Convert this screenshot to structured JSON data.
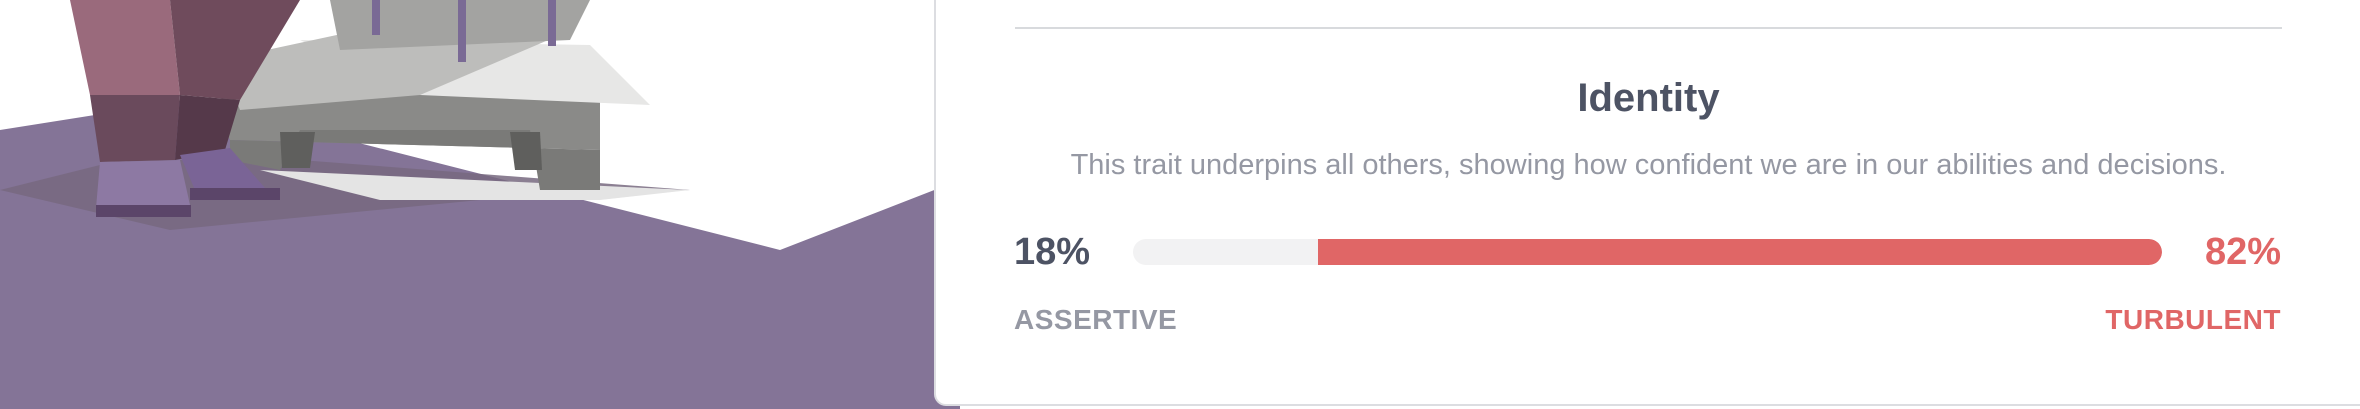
{
  "trait": {
    "title": "Identity",
    "description": "This trait underpins all others, showing how confident we are in our abilities and decisions.",
    "left_percent_label": "18%",
    "right_percent_label": "82%",
    "left_label": "ASSERTIVE",
    "right_label": "TURBULENT",
    "dominant_side": "right",
    "dominant_fraction": 0.82
  },
  "colors": {
    "accent": "#e06666",
    "text_dark": "#4d5364",
    "text_muted": "#9598a3",
    "track": "#f2f2f3",
    "ground": "#847497"
  }
}
